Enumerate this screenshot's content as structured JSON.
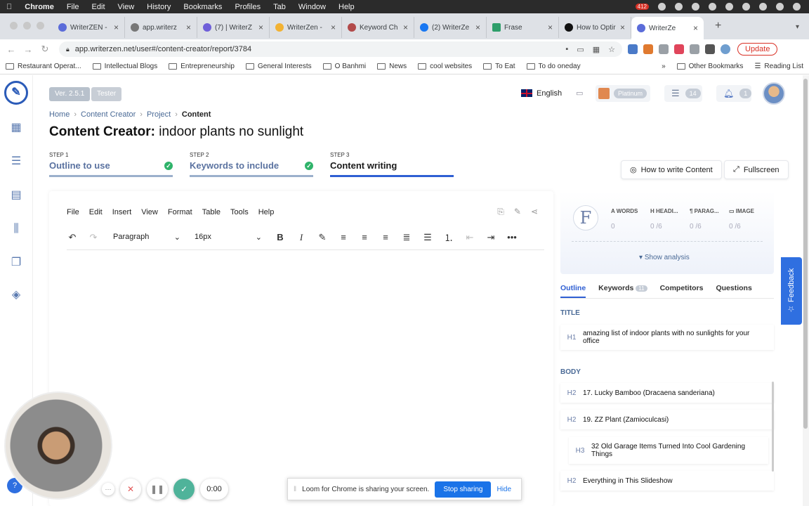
{
  "mac_menu": {
    "app": "Chrome",
    "items": [
      "File",
      "Edit",
      "View",
      "History",
      "Bookmarks",
      "Profiles",
      "Tab",
      "Window",
      "Help"
    ],
    "badge": "412"
  },
  "tabs": [
    {
      "label": "WriterZEN -"
    },
    {
      "label": "app.writerz"
    },
    {
      "label": "(7) | WriterZ"
    },
    {
      "label": "WriterZen -"
    },
    {
      "label": "Keyword Ch"
    },
    {
      "label": "(2) WriterZe"
    },
    {
      "label": "Frase"
    },
    {
      "label": "How to Optir"
    },
    {
      "label": "WriterZe"
    }
  ],
  "address": {
    "url": "app.writerzen.net/user#/content-creator/report/3784",
    "update": "Update"
  },
  "bookmarks": [
    "Restaurant Operat...",
    "Intellectual Blogs",
    "Entrepreneurship",
    "General Interests",
    "O Banhmi",
    "News",
    "cool websites",
    "To Eat",
    "To do oneday"
  ],
  "bookmarks_right": [
    "Other Bookmarks",
    "Reading List"
  ],
  "header": {
    "version": "Ver. 2.5.1",
    "role": "Tester",
    "language": "English",
    "plan": "Platinum",
    "list_count": "14",
    "notif_count": "1"
  },
  "breadcrumb": [
    "Home",
    "Content Creator",
    "Project",
    "Content"
  ],
  "page_title": {
    "prefix": "Content Creator:",
    "topic": "indoor plants no sunlight"
  },
  "steps": [
    {
      "label": "STEP 1",
      "name": "Outline to use",
      "done": true
    },
    {
      "label": "STEP 2",
      "name": "Keywords to include",
      "done": true
    },
    {
      "label": "STEP 3",
      "name": "Content writing",
      "done": false
    }
  ],
  "buttons": {
    "how_to": "How to write Content",
    "fullscreen": "Fullscreen"
  },
  "editor": {
    "menu": [
      "File",
      "Edit",
      "Insert",
      "View",
      "Format",
      "Table",
      "Tools",
      "Help"
    ],
    "block": "Paragraph",
    "size": "16px"
  },
  "analysis": {
    "grade": "F",
    "stats": [
      {
        "label": "WORDS",
        "value": "0"
      },
      {
        "label": "HEADI...",
        "value": "0 /6"
      },
      {
        "label": "PARAG...",
        "value": "0 /6"
      },
      {
        "label": "IMAGE",
        "value": "0 /6"
      }
    ],
    "show": "Show analysis"
  },
  "panel_tabs": [
    {
      "label": "Outline"
    },
    {
      "label": "Keywords",
      "count": "11"
    },
    {
      "label": "Competitors"
    },
    {
      "label": "Questions"
    }
  ],
  "outline": {
    "title_label": "TITLE",
    "title": {
      "tag": "H1",
      "text": "amazing list of indoor plants with no sunlights for your office"
    },
    "body_label": "BODY",
    "items": [
      {
        "tag": "H2",
        "text": "17. Lucky Bamboo (Dracaena sanderiana)"
      },
      {
        "tag": "H2",
        "text": "19. ZZ Plant (Zamioculcasi)"
      },
      {
        "tag": "H3",
        "text": "32 Old Garage Items Turned Into Cool Gardening Things"
      },
      {
        "tag": "H2",
        "text": "Everything in This Slideshow"
      }
    ]
  },
  "feedback": "Feedback",
  "loom": {
    "timer": "0:00",
    "message": "Loom for Chrome is sharing your screen.",
    "stop": "Stop sharing",
    "hide": "Hide"
  }
}
